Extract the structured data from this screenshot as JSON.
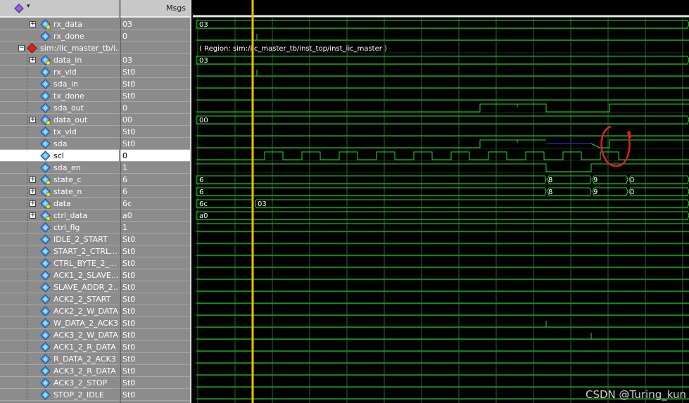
{
  "header": {
    "msgs_label": "Msgs"
  },
  "instance_note": "( Region: sim:/iic_master_tb/inst_top/inst_iic_master )",
  "signals": [
    {
      "label": "rx_data",
      "value": "03",
      "kind": "bus",
      "indent": 1
    },
    {
      "label": "rx_done",
      "value": "0",
      "kind": "bit",
      "indent": 1
    },
    {
      "label": "sim:/iic_master_tb/i...",
      "value": "",
      "kind": "instance",
      "indent": 0
    },
    {
      "label": "data_in",
      "value": "03",
      "kind": "bus",
      "indent": 1
    },
    {
      "label": "rx_vld",
      "value": "St0",
      "kind": "bit",
      "indent": 1
    },
    {
      "label": "sda_in",
      "value": "St0",
      "kind": "bit",
      "indent": 1
    },
    {
      "label": "tx_done",
      "value": "St0",
      "kind": "bit",
      "indent": 1
    },
    {
      "label": "sda_out",
      "value": "0",
      "kind": "bit",
      "indent": 1
    },
    {
      "label": "data_out",
      "value": "00",
      "kind": "bus",
      "indent": 1
    },
    {
      "label": "tx_vld",
      "value": "St0",
      "kind": "bit",
      "indent": 1
    },
    {
      "label": "sda",
      "value": "St0",
      "kind": "bit",
      "indent": 1
    },
    {
      "label": "scl",
      "value": "0",
      "kind": "bit",
      "indent": 1,
      "selected": true
    },
    {
      "label": "sda_en",
      "value": "1",
      "kind": "bit",
      "indent": 1
    },
    {
      "label": "state_c",
      "value": "6",
      "kind": "bus",
      "indent": 1
    },
    {
      "label": "state_n",
      "value": "6",
      "kind": "bus",
      "indent": 1
    },
    {
      "label": "data",
      "value": "6c",
      "kind": "bus",
      "indent": 1
    },
    {
      "label": "ctrl_data",
      "value": "a0",
      "kind": "bus",
      "indent": 1
    },
    {
      "label": "ctrl_flg",
      "value": "1",
      "kind": "bit",
      "indent": 1
    },
    {
      "label": "IDLE_2_START",
      "value": "St0",
      "kind": "bit",
      "indent": 1
    },
    {
      "label": "START_2_CTRL...",
      "value": "St0",
      "kind": "bit",
      "indent": 1
    },
    {
      "label": "CTRL_BYTE_2_...",
      "value": "St0",
      "kind": "bit",
      "indent": 1
    },
    {
      "label": "ACK1_2_SLAVE...",
      "value": "St0",
      "kind": "bit",
      "indent": 1
    },
    {
      "label": "SLAVE_ADDR_2...",
      "value": "St0",
      "kind": "bit",
      "indent": 1
    },
    {
      "label": "ACK2_2_START",
      "value": "St0",
      "kind": "bit",
      "indent": 1
    },
    {
      "label": "ACK2_2_W_DATA",
      "value": "St0",
      "kind": "bit",
      "indent": 1
    },
    {
      "label": "W_DATA_2_ACK3",
      "value": "St0",
      "kind": "bit",
      "indent": 1
    },
    {
      "label": "ACK3_2_W_DATA",
      "value": "St0",
      "kind": "bit",
      "indent": 1
    },
    {
      "label": "ACK1_2_R_DATA",
      "value": "St0",
      "kind": "bit",
      "indent": 1
    },
    {
      "label": "R_DATA_2_ACK3",
      "value": "St0",
      "kind": "bit",
      "indent": 1
    },
    {
      "label": "ACK3_2_R_DATA",
      "value": "St0",
      "kind": "bit",
      "indent": 1
    },
    {
      "label": "ACK3_2_STOP",
      "value": "St0",
      "kind": "bit",
      "indent": 1
    },
    {
      "label": "STOP_2_IDLE",
      "value": "St0",
      "kind": "bit",
      "indent": 1
    }
  ],
  "bus_labels": {
    "rx_data": [
      "03"
    ],
    "data_in": [
      "03"
    ],
    "data_out": [
      "00"
    ],
    "state_c": [
      "6",
      "8",
      "9",
      "0"
    ],
    "state_n": [
      "6",
      "8",
      "9",
      "0"
    ],
    "data": [
      "6c",
      "03"
    ],
    "ctrl_data": [
      "a0"
    ]
  },
  "watermark": "CSDN @Turing_kun",
  "colors": {
    "wave": "#22dd22",
    "cursor": "#f0c000",
    "highlight_z": "#2040ff",
    "annotation": "#e02020",
    "grid": "#1f6e1f"
  }
}
